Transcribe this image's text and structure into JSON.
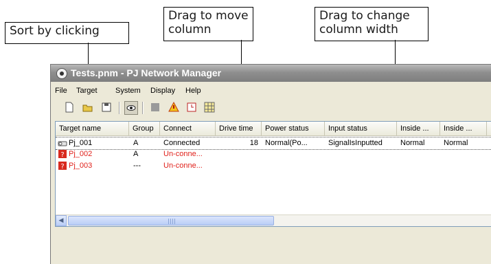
{
  "callouts": {
    "sort": "Sort by clicking",
    "move_line1": "Drag to move",
    "move_line2": "column",
    "width_line1": "Drag to change",
    "width_line2": "column width"
  },
  "window": {
    "title": "Tests.pnm - PJ Network Manager"
  },
  "menu": [
    "File",
    "Target",
    "System",
    "Display",
    "Help"
  ],
  "toolbar": [
    "new-file-icon",
    "open-folder-icon",
    "save-icon",
    "monitor-eye-icon",
    "gray-box-icon",
    "warning-icon",
    "clock-icon",
    "grid-icon"
  ],
  "columns": [
    "Target name",
    "Group",
    "Connect",
    "Drive time",
    "Power status",
    "Input status",
    "Inside ...",
    "Inside ..."
  ],
  "rows": [
    {
      "name": "Pj_001",
      "group": "A",
      "connect": "Connected",
      "drive": "18",
      "power": "Normal(Po...",
      "input": "SignalIsInputted",
      "inside1": "Normal",
      "inside2": "Normal",
      "status_color": "#000000"
    },
    {
      "name": "Pj_002",
      "group": "A",
      "connect": "Un-conne...",
      "status_color": "#e0201a"
    },
    {
      "name": "Pj_003",
      "group": "---",
      "connect": "Un-conne...",
      "status_color": "#e0201a"
    }
  ],
  "colors": {
    "title_gradient": "#8f8f8f",
    "error_text": "#e0201a",
    "scroll_thumb": "#b9cdf6"
  }
}
